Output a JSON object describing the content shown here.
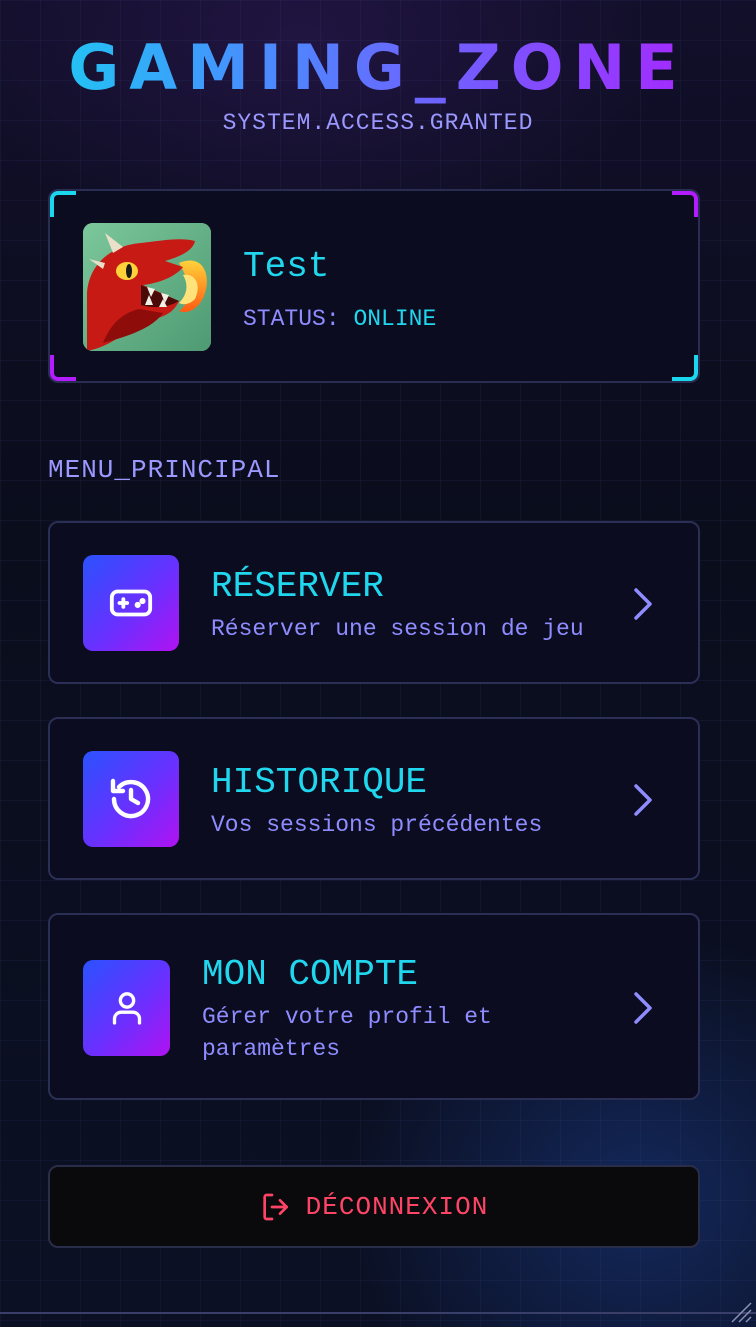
{
  "header": {
    "title": "GAMING_ZONE",
    "subtitle": "SYSTEM.ACCESS.GRANTED"
  },
  "profile": {
    "username": "Test",
    "status_label": "STATUS:",
    "status_value": "ONLINE",
    "avatar_icon": "red-dragon-avatar"
  },
  "menu": {
    "section_label": "MENU_PRINCIPAL",
    "items": [
      {
        "title": "RÉSERVER",
        "description": "Réserver une session de jeu",
        "icon": "gamepad-icon"
      },
      {
        "title": "HISTORIQUE",
        "description": "Vos sessions précédentes",
        "icon": "history-icon"
      },
      {
        "title": "MON COMPTE",
        "description": "Gérer votre profil et paramètres",
        "icon": "user-icon"
      }
    ]
  },
  "logout": {
    "label": "DÉCONNEXION",
    "icon": "logout-icon"
  },
  "colors": {
    "cyan": "#20d7ee",
    "violet": "#8f8cff",
    "magenta": "#b21cff",
    "danger": "#ff4466",
    "card_bg": "#0b0c20"
  }
}
